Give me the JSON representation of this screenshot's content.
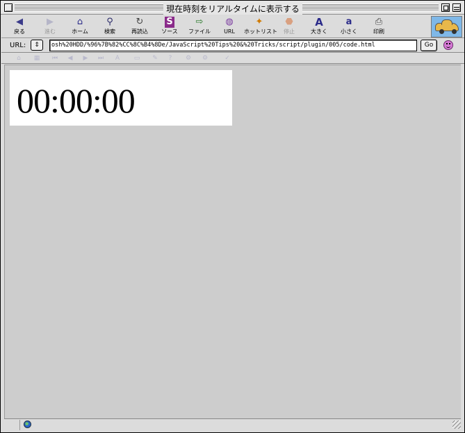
{
  "window": {
    "title": "現在時刻をリアルタイムに表示する"
  },
  "toolbar": {
    "items": [
      {
        "label": "戻る",
        "icon": "back-arrow-icon",
        "glyph": "◀",
        "color": "#3a3a8a"
      },
      {
        "label": "進む",
        "icon": "forward-arrow-icon",
        "glyph": "▶",
        "color": "#b0b0c8"
      },
      {
        "label": "ホーム",
        "icon": "home-icon",
        "glyph": "⌂",
        "color": "#2b2b8a"
      },
      {
        "label": "検索",
        "icon": "search-icon",
        "glyph": "⚲",
        "color": "#2b2b6a"
      },
      {
        "label": "再読込",
        "icon": "reload-icon",
        "glyph": "↻",
        "color": "#444"
      },
      {
        "label": "ソース",
        "icon": "source-icon",
        "glyph": "S",
        "color": "#8a2b8a"
      },
      {
        "label": "ファイル",
        "icon": "file-icon",
        "glyph": "⇨",
        "color": "#2b7a2b"
      },
      {
        "label": "URL",
        "icon": "url-globe-icon",
        "glyph": "◍",
        "color": "#7a3aa0"
      },
      {
        "label": "ホットリスト",
        "icon": "hotlist-icon",
        "glyph": "✦",
        "color": "#d07a00"
      },
      {
        "label": "停止",
        "icon": "stop-icon",
        "glyph": "⬣",
        "color": "#d9a080"
      },
      {
        "label": "大きく",
        "icon": "font-larger-icon",
        "glyph": "A",
        "color": "#2b2b8a"
      },
      {
        "label": "小さく",
        "icon": "font-smaller-icon",
        "glyph": "a",
        "color": "#2b2b8a"
      },
      {
        "label": "印刷",
        "icon": "print-icon",
        "glyph": "⎙",
        "color": "#444"
      }
    ]
  },
  "urlbar": {
    "label": "URL:",
    "value": "osh%20HDD/%96%7B%82%CC%8C%B4%8De/JavaScript%20Tips%20&%20Tricks/script/plugin/005/code.html",
    "go_label": "Go"
  },
  "page": {
    "clock": "00:00:00"
  }
}
